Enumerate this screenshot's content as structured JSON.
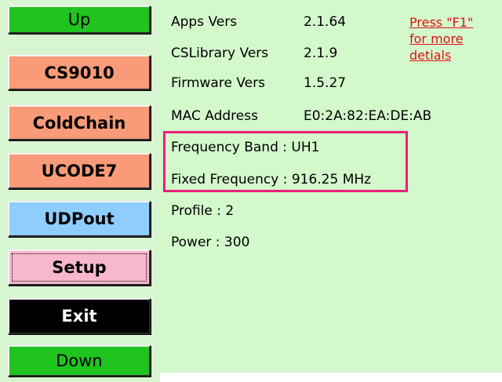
{
  "colors": {
    "sidebar_bg": "#d8f5d1",
    "content_bg": "#d3f8cc",
    "up_down_button": "#1fc41f",
    "orange_button": "#f99b79",
    "blue_button": "#8fcdfc",
    "pink_button": "#f7b7cd",
    "exit_button": "#000000",
    "highlight_border": "#e8207a",
    "help_text": "#e21010"
  },
  "nav": {
    "up": "Up",
    "cs9010": "CS9010",
    "coldchain": "ColdChain",
    "ucode7": "UCODE7",
    "udpout": "UDPout",
    "setup": "Setup",
    "exit": "Exit",
    "down": "Down"
  },
  "info": {
    "apps_label": "Apps Vers",
    "apps_value": "2.1.64",
    "cslib_label": "CSLibrary Vers",
    "cslib_value": "2.1.9",
    "firmware_label": "Firmware Vers",
    "firmware_value": "1.5.27",
    "mac_label": "MAC Address",
    "mac_value": "E0:2A:82:EA:DE:AB",
    "frequency_band": "Frequency Band : UH1",
    "fixed_frequency": "Fixed Frequency : 916.25 MHz",
    "profile": "Profile : 2",
    "power": "Power : 300"
  },
  "help": {
    "line1": "Press \"F1\"",
    "line2": "for more",
    "line3": "detials"
  }
}
